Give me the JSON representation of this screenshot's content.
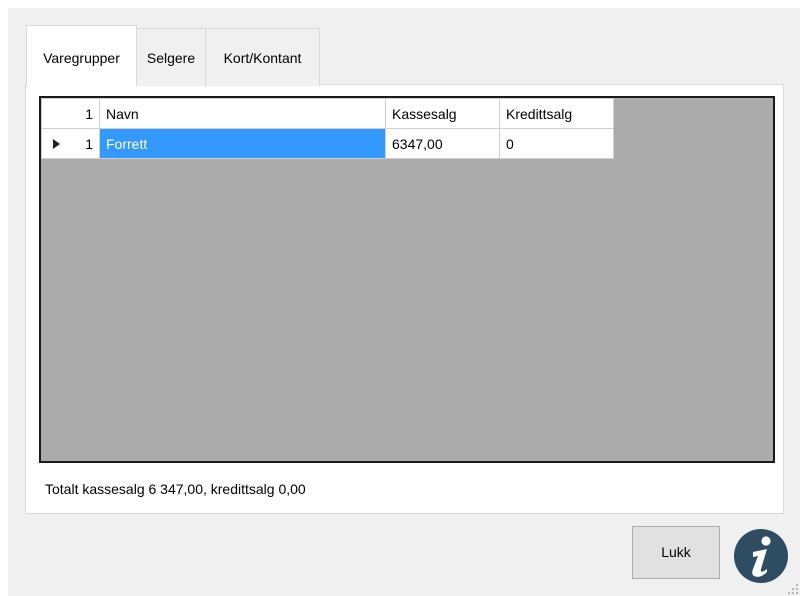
{
  "tabs": [
    {
      "label": "Varegrupper",
      "active": true
    },
    {
      "label": "Selgere",
      "active": false
    },
    {
      "label": "Kort/Kontant",
      "active": false
    }
  ],
  "grid": {
    "corner_value": "1",
    "columns": [
      "Navn",
      "Kassesalg",
      "Kredittsalg"
    ],
    "rows": [
      {
        "row_number": "1",
        "navn": "Forrett",
        "kassesalg": "6347,00",
        "kredittsalg": "0",
        "selected_cell": "navn"
      }
    ],
    "background_color": "#ababab",
    "selection_color": "#3399ff"
  },
  "summary": {
    "text": "Totalt kassesalg 6 347,00, kredittsalg 0,00"
  },
  "buttons": {
    "close_label": "Lukk"
  },
  "icons": {
    "info": "info-icon",
    "row_pointer": "row-pointer-icon",
    "resize_grip": "resize-grip-icon"
  },
  "colors": {
    "window_bg": "#f0f0f0",
    "info_icon_bg": "#2e4d63"
  }
}
